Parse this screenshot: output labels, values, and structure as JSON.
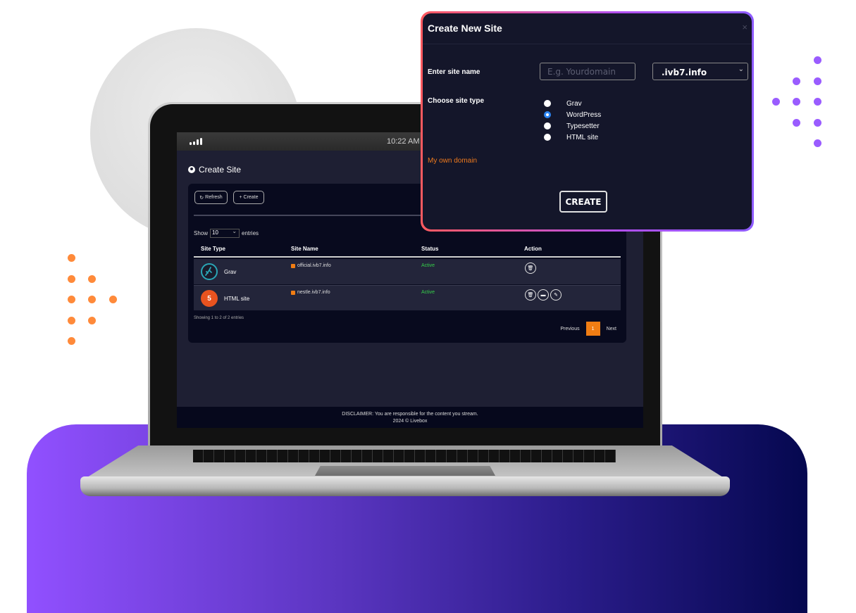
{
  "modal": {
    "title": "Create New Site",
    "close_icon": "×",
    "site_name_label": "Enter site name",
    "site_name_placeholder": "E.g. Yourdomain",
    "site_name_value": "",
    "domain_select_value": ".ivb7.info",
    "site_type_label": "Choose site type",
    "site_types": [
      {
        "label": "Grav",
        "checked": false
      },
      {
        "label": "WordPress",
        "checked": true
      },
      {
        "label": "Typesetter",
        "checked": false
      },
      {
        "label": "HTML site",
        "checked": false
      }
    ],
    "own_domain_link": "My own domain",
    "create_button": "CREATE"
  },
  "device": {
    "time": "10:22 AM",
    "signal_icon": "signal-bars"
  },
  "app": {
    "page_title": "Create Site",
    "page_icon": "globe-icon",
    "toolbar": {
      "refresh": "Refresh",
      "create": "Create"
    },
    "entries": {
      "show": "Show",
      "value": "10",
      "suffix": "entries"
    },
    "table": {
      "columns": [
        "Site Type",
        "Site Name",
        "Status",
        "Action"
      ],
      "rows": [
        {
          "type": "Grav",
          "type_icon": "grav-logo",
          "name": "official.ivb7.info",
          "status": "Active",
          "actions": [
            "delete"
          ]
        },
        {
          "type": "HTML site",
          "type_icon": "html5-logo",
          "name": "nestle.ivb7.info",
          "status": "Active",
          "actions": [
            "delete",
            "folder",
            "edit"
          ]
        }
      ]
    },
    "showing": "Showing 1 to 2 of 2 entries",
    "pagination": {
      "previous": "Previous",
      "current": "1",
      "next": "Next"
    },
    "footer": {
      "disclaimer": "DISCLAIMER: You are responsible for the content you stream.",
      "copyright": "2024 © Livebox"
    }
  },
  "colors": {
    "accent_orange": "#f07d13",
    "active_green": "#36d04a",
    "radio_blue": "#2b84f3",
    "modal_bg": "#14162a"
  }
}
